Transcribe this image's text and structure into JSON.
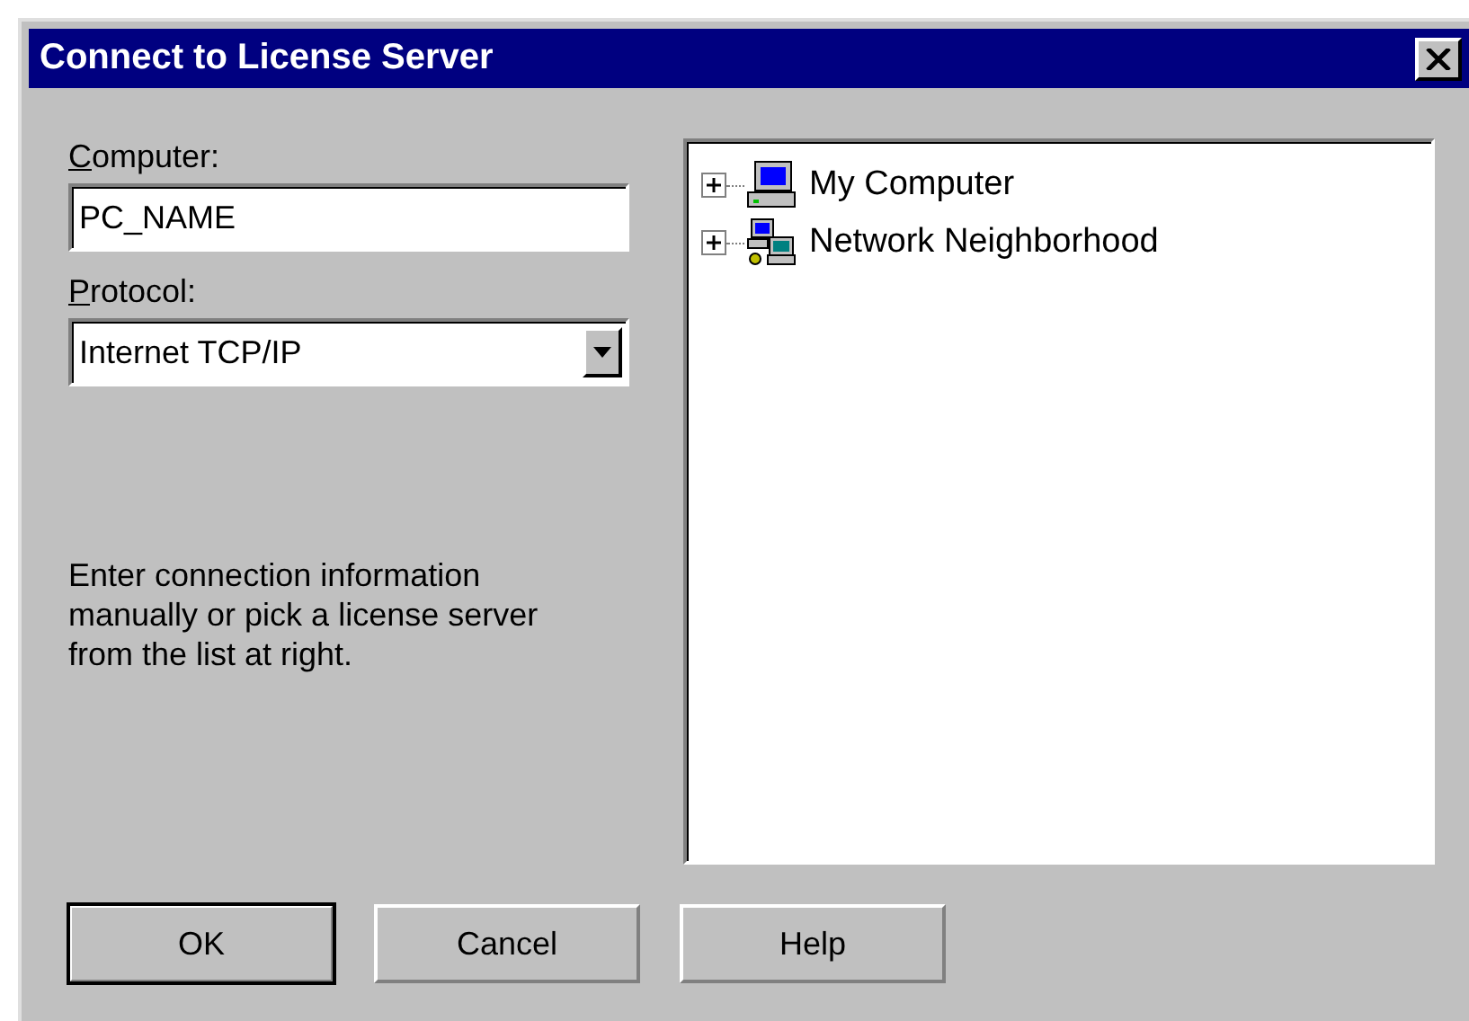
{
  "window": {
    "title": "Connect to License Server"
  },
  "computer": {
    "label": "Computer:",
    "value": "PC_NAME"
  },
  "protocol": {
    "label": "Protocol:",
    "value": "Internet TCP/IP"
  },
  "hint": "Enter connection information manually or pick a license server from the list at right.",
  "tree": [
    {
      "label": "My Computer",
      "kind": "computer",
      "expanded": false
    },
    {
      "label": "Network Neighborhood",
      "kind": "network",
      "expanded": false
    }
  ],
  "buttons": [
    {
      "label": "OK",
      "default": true
    },
    {
      "label": "Cancel",
      "default": false
    },
    {
      "label": "Help",
      "default": false
    }
  ]
}
